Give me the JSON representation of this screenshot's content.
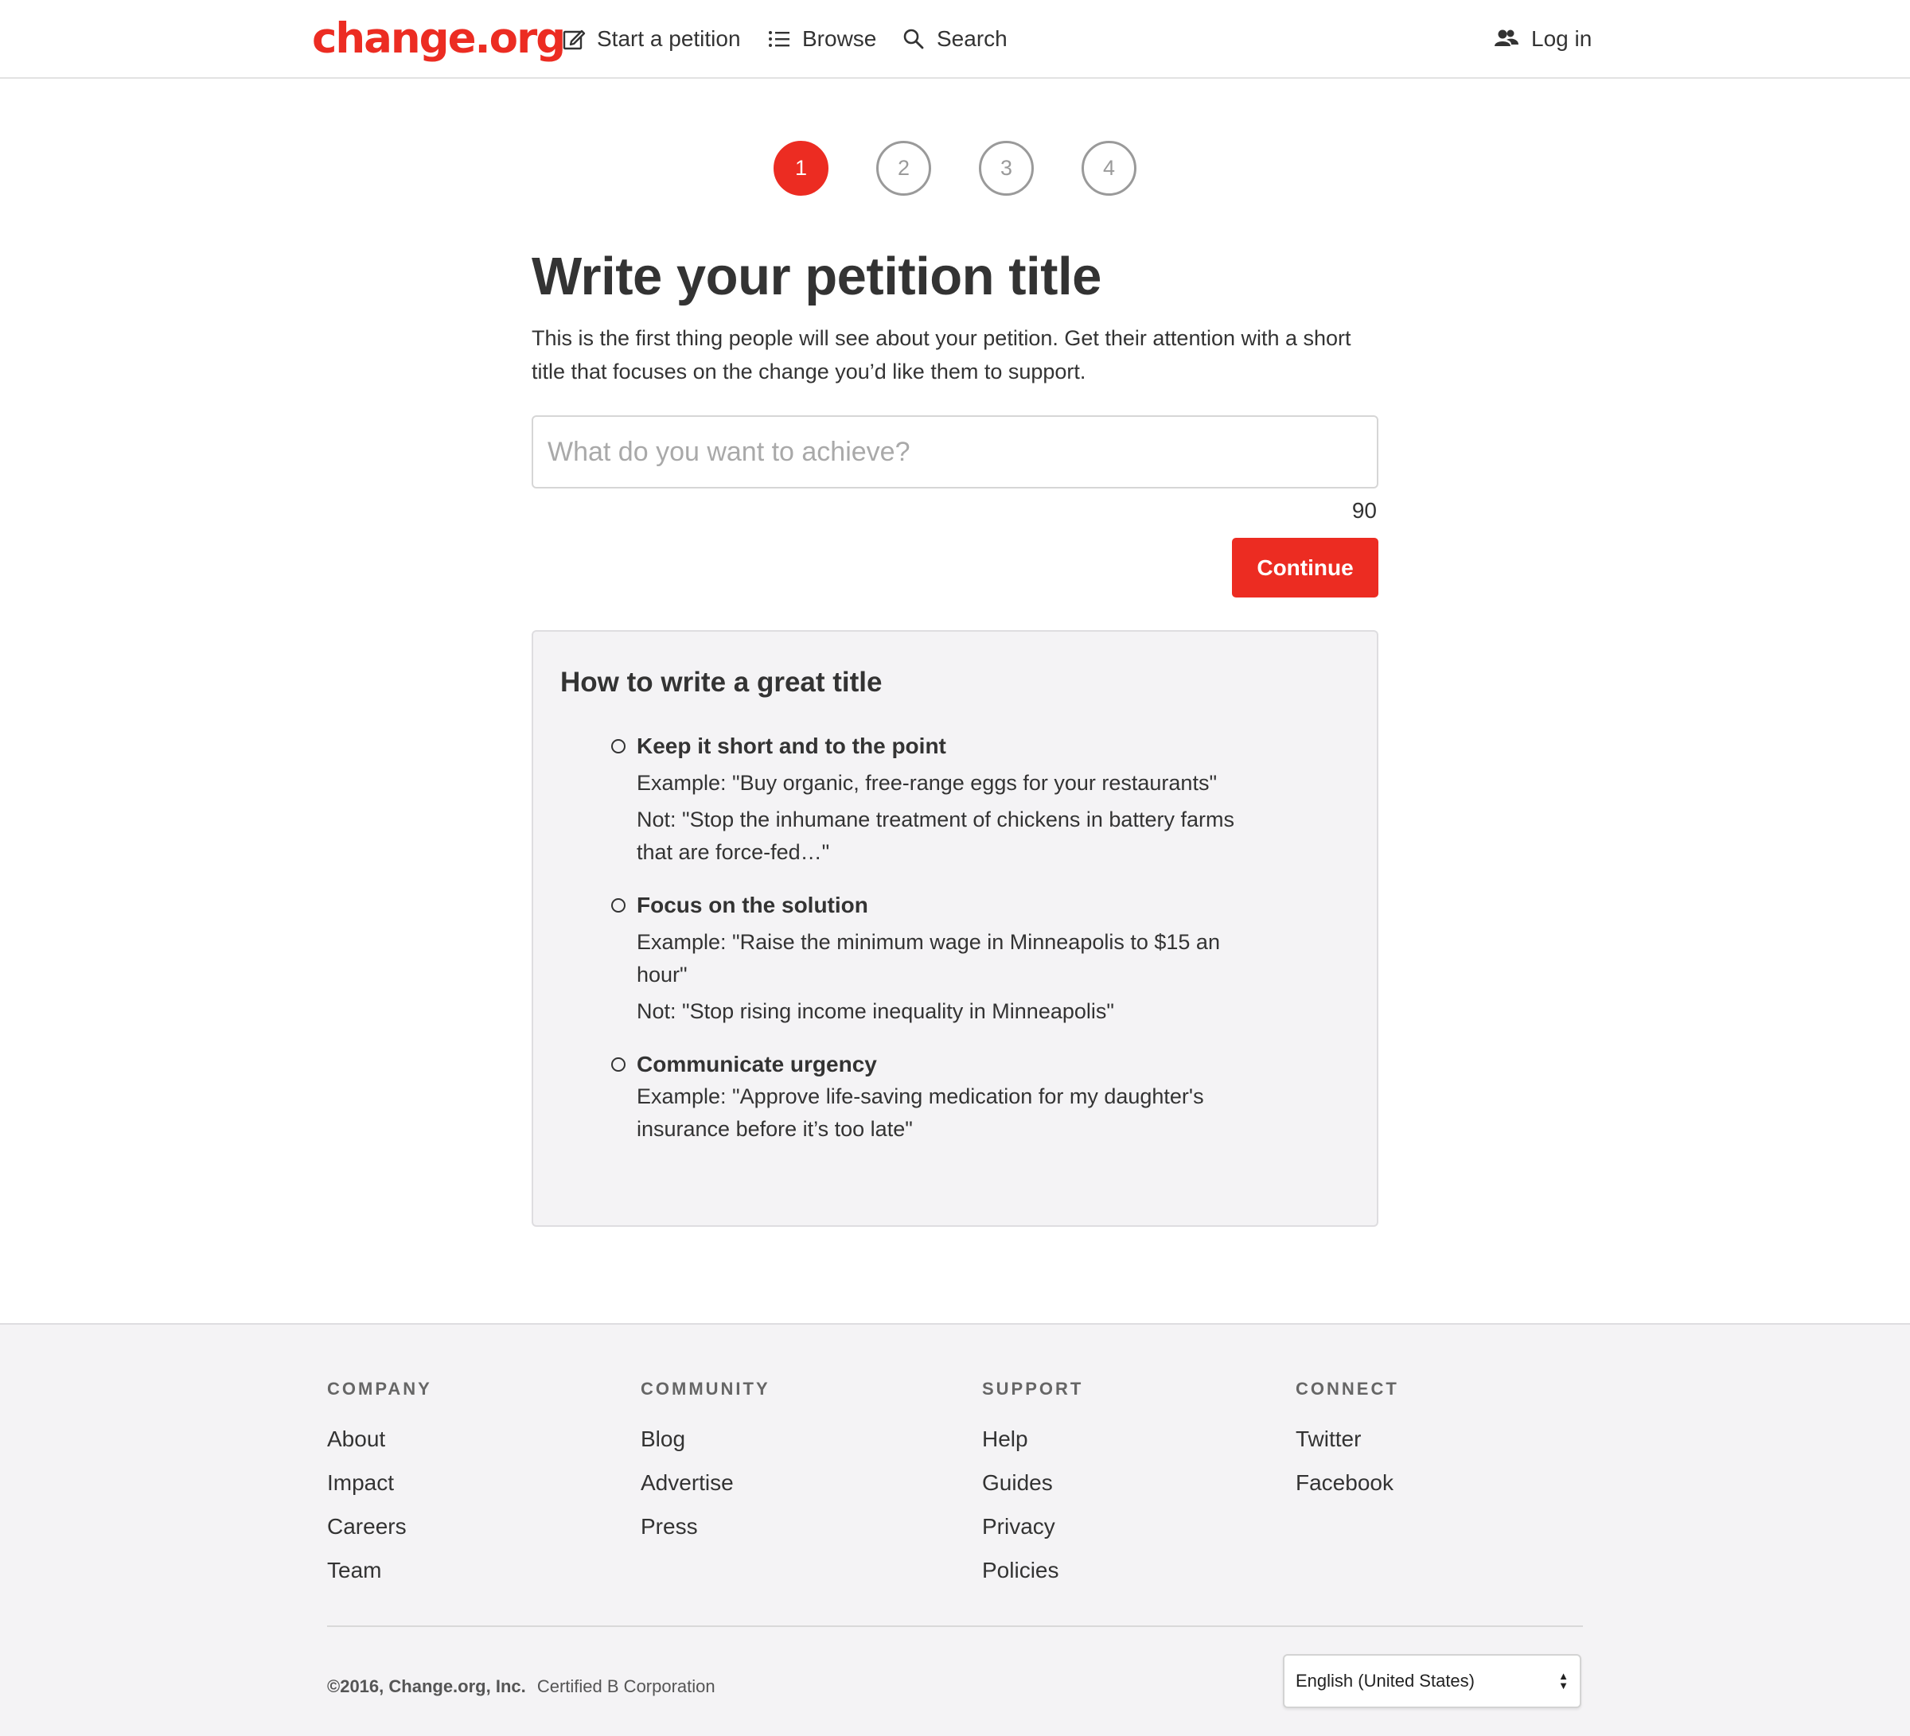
{
  "header": {
    "logo": "change.org",
    "nav": {
      "start_petition": "Start a petition",
      "browse": "Browse",
      "search": "Search",
      "login": "Log in"
    }
  },
  "stepper": {
    "steps": [
      "1",
      "2",
      "3",
      "4"
    ],
    "active_step": "1"
  },
  "main": {
    "title": "Write your petition title",
    "intro": "This is the first thing people will see about your petition. Get their attention with a short title that focuses on the change you’d like them to support.",
    "title_input": {
      "value": "",
      "placeholder": "What do you want to achieve?"
    },
    "char_count": "90",
    "continue_label": "Continue"
  },
  "tips": {
    "title": "How to write a great title",
    "items": [
      {
        "heading": "Keep it short and to the point",
        "lines": [
          "Example: \"Buy organic, free-range eggs for your restaurants\"",
          "Not: \"Stop the inhumane treatment of chickens in battery farms that are force-fed…\""
        ]
      },
      {
        "heading": "Focus on the solution",
        "lines": [
          "Example: \"Raise the minimum wage in Minneapolis to $15 an hour\"",
          "Not: \"Stop rising income inequality in Minneapolis\""
        ]
      },
      {
        "heading": "Communicate urgency",
        "lines": [
          "Example: \"Approve life-saving medication for my daughter's insurance before it’s too late\""
        ]
      }
    ]
  },
  "footer": {
    "columns": [
      {
        "heading": "COMPANY",
        "links": [
          "About",
          "Impact",
          "Careers",
          "Team"
        ]
      },
      {
        "heading": "COMMUNITY",
        "links": [
          "Blog",
          "Advertise",
          "Press"
        ]
      },
      {
        "heading": "SUPPORT",
        "links": [
          "Help",
          "Guides",
          "Privacy",
          "Policies"
        ]
      },
      {
        "heading": "CONNECT",
        "links": [
          "Twitter",
          "Facebook"
        ]
      }
    ],
    "copyright": "©2016, Change.org, Inc.",
    "certified": "Certified B Corporation",
    "language": "English (United States)"
  },
  "colors": {
    "brand_red": "#ec2c22",
    "text": "#333333",
    "panel_bg": "#f4f3f5"
  }
}
